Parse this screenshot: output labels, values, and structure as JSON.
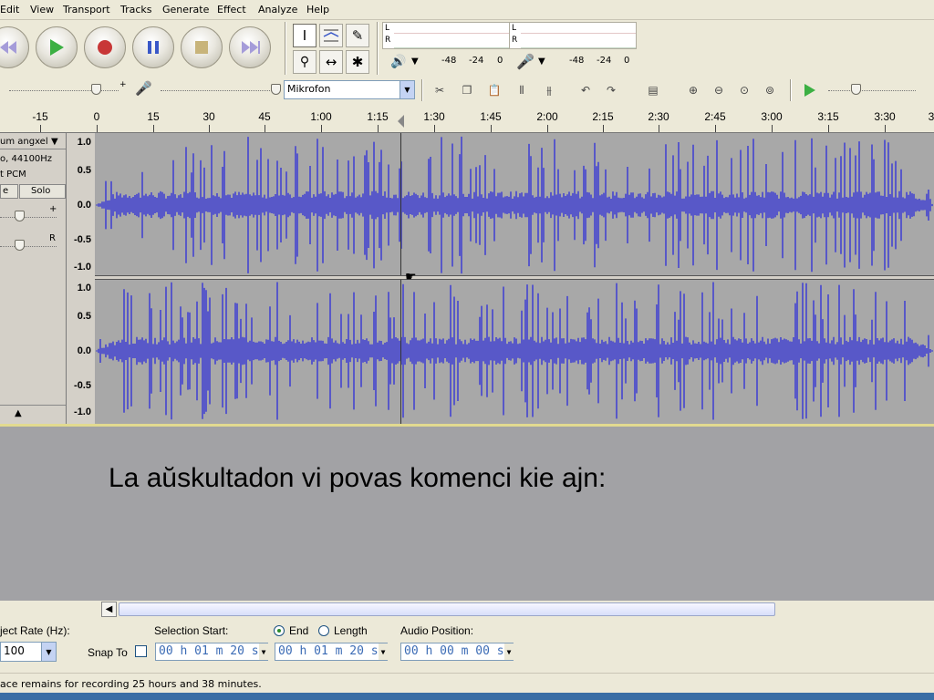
{
  "menu": [
    "Edit",
    "View",
    "Transport",
    "Tracks",
    "Generate",
    "Effect",
    "Analyze",
    "Help"
  ],
  "transport": {
    "skip_start": "skip-to-start",
    "play": "play",
    "record": "record",
    "pause": "pause",
    "stop": "stop",
    "skip_end": "skip-to-end"
  },
  "meters": {
    "left_label": "L",
    "right_label": "R",
    "play_scale": [
      "-48",
      "-24",
      "0"
    ],
    "rec_scale": [
      "-48",
      "-24",
      "0"
    ]
  },
  "device": {
    "input_source": "Mikrofon"
  },
  "ruler": {
    "labels": [
      "-15",
      "0",
      "15",
      "30",
      "45",
      "1:00",
      "1:15",
      "1:30",
      "1:45",
      "2:00",
      "2:15",
      "2:30",
      "2:45",
      "3:00",
      "3:15",
      "3:30",
      "3"
    ]
  },
  "track": {
    "name": "um angxel",
    "info_rate": "o, 44100Hz",
    "info_format": "t PCM",
    "mute": "e",
    "solo": "Solo",
    "gain_plus": "+",
    "pan_right": "R",
    "collapse": "▲",
    "scale": [
      "1.0",
      "0.5",
      "0.0",
      "-0.5",
      "-1.0"
    ]
  },
  "slide": {
    "text": "La aŭskultadon vi povas komenci kie ajn:"
  },
  "selection": {
    "project_rate_label": "ject Rate (Hz):",
    "project_rate_value": "100",
    "snap_to": "Snap To",
    "selection_start_label": "Selection Start:",
    "end_label": "End",
    "length_label": "Length",
    "audio_position_label": "Audio Position:",
    "start_value": "00 h 01 m 20 s",
    "end_value": "00 h 01 m 20 s",
    "position_value": "00 h 00 m 00 s",
    "end_selected": true
  },
  "status": {
    "text": "ace remains for recording 25 hours and 38 minutes."
  },
  "colors": {
    "waveform": "#3636d6",
    "waveform_bg": "#a8a8a8",
    "play_green": "#3cb043",
    "record_red": "#c83737",
    "time_text": "#3b6bb5"
  }
}
